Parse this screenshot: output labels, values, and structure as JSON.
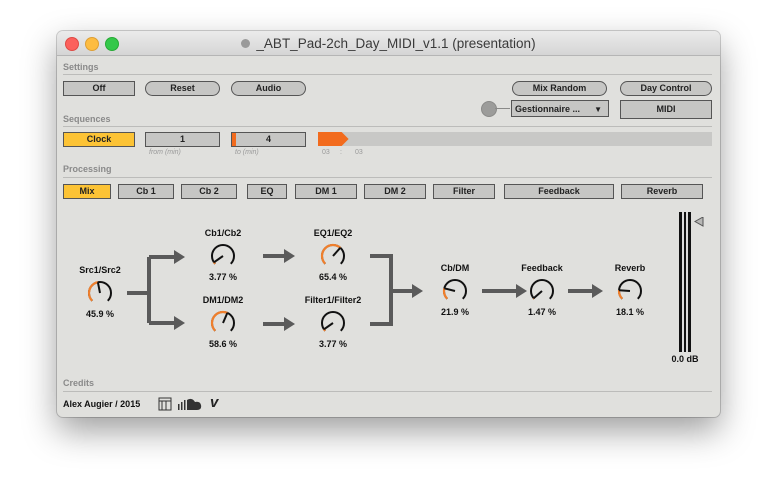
{
  "window": {
    "title": "_ABT_Pad-2ch_Day_MIDI_v1.1 (presentation)"
  },
  "settings": {
    "label": "Settings",
    "off": "Off",
    "reset": "Reset",
    "audio": "Audio",
    "mix_random": "Mix Random",
    "day_control": "Day Control",
    "dropdown_value": "Gestionnaire ...",
    "midi": "MIDI"
  },
  "sequences": {
    "label": "Sequences",
    "clock": "Clock",
    "from_value": "1",
    "from_label": "from (min)",
    "to_value": "4",
    "to_label": "to (min)",
    "progress_fraction": 0.06,
    "time_start_min": "03",
    "time_sep": ":",
    "time_end_sec": "03"
  },
  "processing": {
    "label": "Processing",
    "tabs": [
      {
        "label": "Mix",
        "active": true
      },
      {
        "label": "Cb 1",
        "active": false
      },
      {
        "label": "Cb 2",
        "active": false
      },
      {
        "label": "EQ",
        "active": false
      },
      {
        "label": "DM 1",
        "active": false
      },
      {
        "label": "DM 2",
        "active": false
      },
      {
        "label": "Filter",
        "active": false
      },
      {
        "label": "Feedback",
        "active": false
      },
      {
        "label": "Reverb",
        "active": false
      }
    ],
    "knobs": [
      {
        "label": "Src1/Src2",
        "value": "45.9 %",
        "fraction": 0.459
      },
      {
        "label": "Cb1/Cb2",
        "value": "3.77 %",
        "fraction": 0.0377
      },
      {
        "label": "DM1/DM2",
        "value": "58.6 %",
        "fraction": 0.586
      },
      {
        "label": "EQ1/EQ2",
        "value": "65.4 %",
        "fraction": 0.654
      },
      {
        "label": "Filter1/Filter2",
        "value": "3.77 %",
        "fraction": 0.0377
      },
      {
        "label": "Cb/DM",
        "value": "21.9 %",
        "fraction": 0.219
      },
      {
        "label": "Feedback",
        "value": "1.47 %",
        "fraction": 0.0147
      },
      {
        "label": "Reverb",
        "value": "18.1 %",
        "fraction": 0.181
      }
    ],
    "meter": {
      "value": "0.0 dB"
    }
  },
  "credits": {
    "label": "Credits",
    "author": "Alex Augier / 2015",
    "icons": [
      "logo-icon",
      "soundcloud-icon",
      "vimeo-icon"
    ]
  },
  "colors": {
    "accent": "#fcc335",
    "knob_arc": "#f07f2c",
    "progress": "#f26b1d"
  }
}
